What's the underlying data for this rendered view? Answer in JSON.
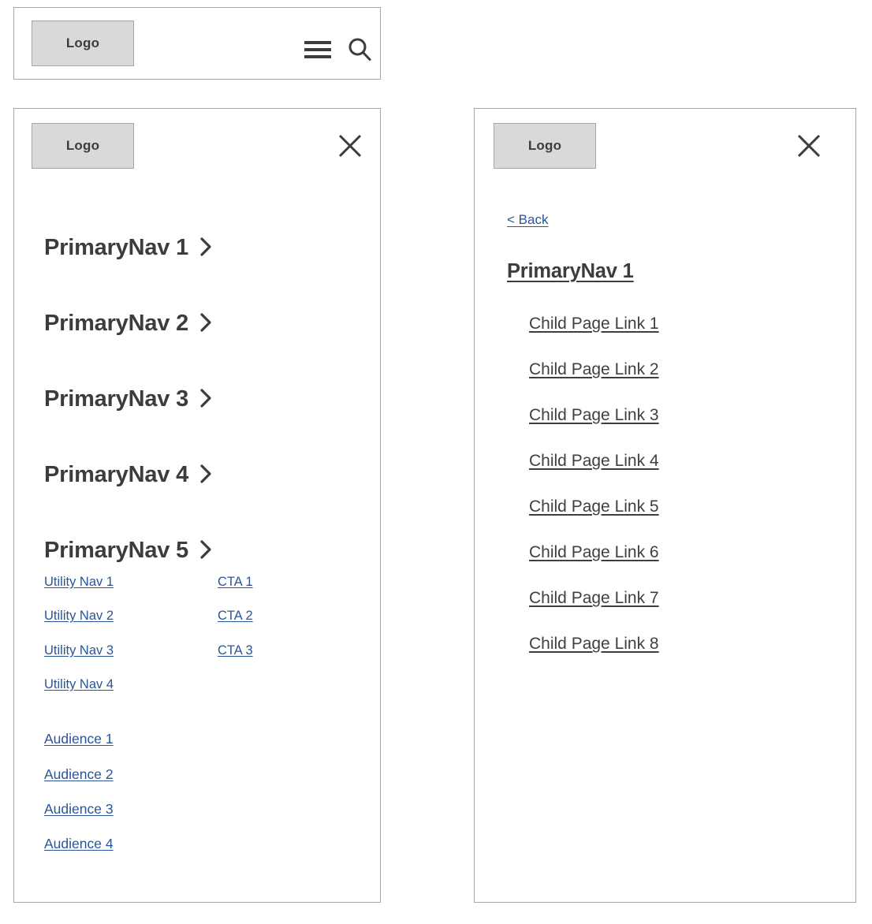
{
  "header": {
    "logo_label": "Logo",
    "menu_icon": "hamburger-menu-icon",
    "search_icon": "search-icon"
  },
  "primary_panel": {
    "logo_label": "Logo",
    "close_icon": "close-x-icon",
    "nav_items": [
      {
        "label": "PrimaryNav 1",
        "chevron": "chevron-right-icon"
      },
      {
        "label": "PrimaryNav 2",
        "chevron": "chevron-right-icon"
      },
      {
        "label": "PrimaryNav 3",
        "chevron": "chevron-right-icon"
      },
      {
        "label": "PrimaryNav 4",
        "chevron": "chevron-right-icon"
      },
      {
        "label": "PrimaryNav 5",
        "chevron": "chevron-right-icon"
      }
    ],
    "utility_nav": [
      "Utility Nav 1",
      "Utility Nav 2",
      "Utility Nav 3",
      "Utility Nav 4"
    ],
    "cta_links": [
      "CTA 1",
      "CTA 2",
      "CTA 3"
    ],
    "audience_links": [
      "Audience 1",
      "Audience 2",
      "Audience 3",
      "Audience 4"
    ]
  },
  "child_panel": {
    "logo_label": "Logo",
    "close_icon": "close-x-icon",
    "back_label": "< Back",
    "heading": "PrimaryNav 1",
    "child_links": [
      "Child Page Link 1",
      "Child Page Link 2",
      "Child Page Link 3",
      "Child Page Link 4",
      "Child Page Link 5",
      "Child Page Link 6",
      "Child Page Link 7",
      "Child Page Link 8"
    ]
  },
  "colors": {
    "panel_border": "#a6a6a6",
    "logo_fill": "#d9d9d9",
    "text_dark": "#3c3c3c",
    "link_blue": "#2a5599",
    "child_link": "#3f3f3f",
    "background": "#ffffff"
  }
}
